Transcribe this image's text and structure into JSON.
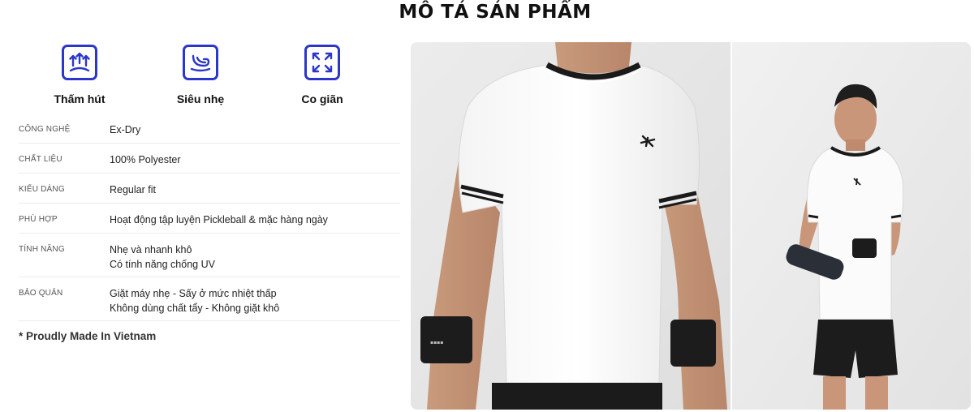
{
  "section_title": "MÔ TẢ SẢN PHẨM",
  "features": [
    {
      "label": "Thấm hút",
      "icon": "moisture-wicking-icon"
    },
    {
      "label": "Siêu nhẹ",
      "icon": "lightweight-icon"
    },
    {
      "label": "Co giãn",
      "icon": "stretch-icon"
    }
  ],
  "specs": [
    {
      "key": "CÔNG NGHỆ",
      "values": [
        "Ex-Dry"
      ]
    },
    {
      "key": "CHẤT LIỆU",
      "values": [
        "100% Polyester"
      ]
    },
    {
      "key": "KIỂU DÁNG",
      "values": [
        "Regular fit"
      ]
    },
    {
      "key": "PHÙ HỢP",
      "values": [
        "Hoạt động tập luyện Pickleball & mặc hàng ngày"
      ]
    },
    {
      "key": "TÍNH NĂNG",
      "values": [
        "Nhẹ và nhanh khô",
        "Có tính năng chống UV"
      ]
    },
    {
      "key": "BẢO QUẢN",
      "values": [
        "Giặt máy nhẹ - Sấy ở mức nhiệt thấp",
        "Không dùng chất tẩy - Không giặt khô"
      ]
    }
  ],
  "made_in": "* Proudly Made In Vietnam",
  "colors": {
    "accent": "#2c36c9",
    "text": "#111111",
    "muted": "#555555",
    "divider": "#ececec"
  }
}
